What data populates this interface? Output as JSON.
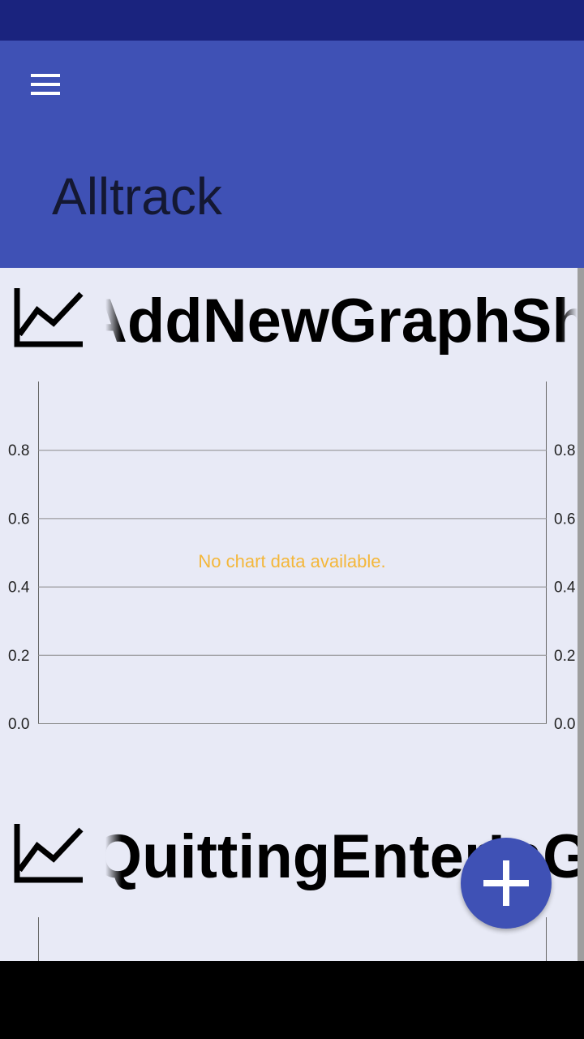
{
  "app": {
    "title": "Alltrack"
  },
  "icons": {
    "menu": "menu-icon",
    "graph": "line-chart-icon",
    "add": "plus-icon"
  },
  "colors": {
    "status_bar": "#1a237e",
    "primary": "#3f51b5",
    "background": "#e8eaf6",
    "no_data_text": "#f4b73a"
  },
  "graphs": [
    {
      "title": "AddNewGraphShortcut",
      "no_data_text": "No chart data available.",
      "left_axis_ticks": [
        "0.0",
        "0.2",
        "0.4",
        "0.6",
        "0.8"
      ],
      "right_axis_ticks": [
        "0.0",
        "0.2",
        "0.4",
        "0.6",
        "0.8"
      ]
    },
    {
      "title": "QuittingEnterInGraph"
    }
  ],
  "chart_data": {
    "type": "line",
    "series": [],
    "ylim": [
      0,
      1
    ],
    "grid": true
  }
}
